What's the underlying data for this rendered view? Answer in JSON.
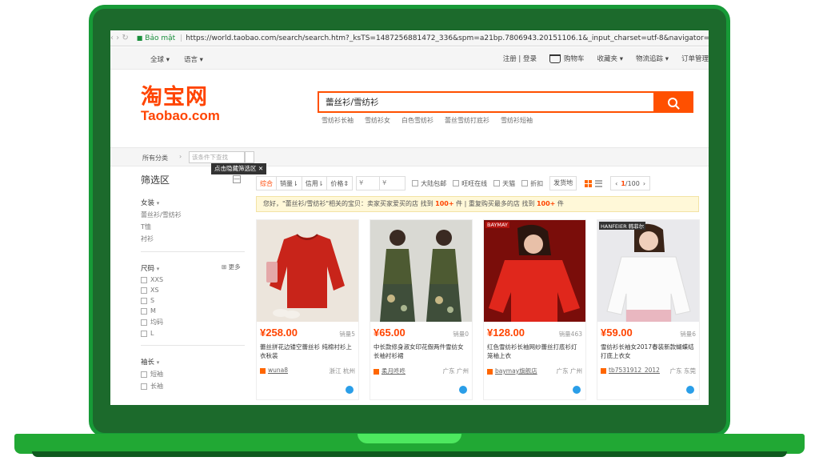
{
  "browser": {
    "secure_label": "Bảo mật",
    "url": "https://world.taobao.com/search/search.htm?_ksTS=1487256881472_336&spm=a21bp.7806943.20151106.1&_input_charset=utf-8&navigator="
  },
  "topbar": {
    "left": [
      "全球 ▾",
      "语言 ▾"
    ],
    "login": "注册 | 登录",
    "cart": "购物车",
    "favorites": "收藏夹 ▾",
    "logistics": "物流追踪 ▾",
    "orders": "订单管理"
  },
  "logo": {
    "cn": "淘宝网",
    "en": "Taobao.com"
  },
  "search": {
    "value": "蕾丝衫/雪纺衫",
    "hot": [
      "雪纺衫长袖",
      "雪纺衫女",
      "白色雪纺衫",
      "蕾丝雪纺打底衫",
      "雪纺衫短袖"
    ]
  },
  "category": {
    "all": "所有分类",
    "placeholder": "该条件下查找",
    "tooltip": "点击隐藏筛选区 ✕"
  },
  "sidebar": {
    "title": "筛选区",
    "collapse": "—",
    "women_title": "女装",
    "women_items": [
      "蕾丝衫/雪纺衫",
      "T恤",
      "衬衫"
    ],
    "size_title": "尺码",
    "more": "更多",
    "sizes": [
      "XXS",
      "XS",
      "S",
      "M",
      "均码",
      "L"
    ],
    "sleeve_title": "袖长",
    "sleeves": [
      "短袖",
      "长袖"
    ]
  },
  "filter": {
    "sort": [
      "综合",
      "销量⇂",
      "信用⇂",
      "价格⇕"
    ],
    "price_from": "¥",
    "price_to": "¥",
    "checks": [
      "大陆包邮",
      "旺旺在线",
      "天猫",
      "折扣"
    ],
    "ship": "发货地",
    "page_current": "1",
    "page_total": "/100"
  },
  "notice": {
    "pre": "您好，\"蕾丝衫/雪纺衫\"相关的宝贝：卖家买家爱买的店 找到 ",
    "count1": "100+",
    "mid": " 件 | 重复购买最多的店 找到 ",
    "count2": "100+",
    "post": " 件"
  },
  "products": [
    {
      "price": "¥258.00",
      "sales": "销量5",
      "title": "蕾丝拼花边镂空蕾丝衫 纯棉衬衫上衣秋装",
      "shop": "wuna8",
      "loc": "浙江 杭州"
    },
    {
      "price": "¥65.00",
      "sales": "销量0",
      "title": "中长款修身淑女印花假两件雪纺女长袖衬衫裙",
      "shop": "柔月咚咚",
      "loc": "广东 广州"
    },
    {
      "price": "¥128.00",
      "sales": "销量463",
      "title": "红色雪纺衫长袖网纱蕾丝打底衫灯笼袖上衣",
      "shop": "baymay旗舰店",
      "loc": "广东 广州"
    },
    {
      "price": "¥59.00",
      "sales": "销量6",
      "title": "雪纺衫长袖女2017春装新款蝴蝶结打底上衣女",
      "shop": "tb7531912_2012",
      "loc": "广东 东莞"
    }
  ],
  "brand_tags": [
    "BAYMAY",
    "HANFEIER 韩菲尔"
  ],
  "colors": {
    "taobao_orange": "#ff4400",
    "frame_green": "#1c6a2c",
    "base_green": "#21a834"
  }
}
